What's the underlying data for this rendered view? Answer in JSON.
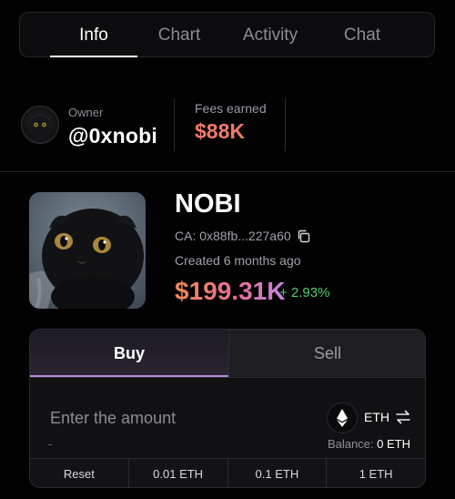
{
  "tabs": [
    "Info",
    "Chart",
    "Activity",
    "Chat"
  ],
  "owner": {
    "label": "Owner",
    "value": "@0xnobi"
  },
  "fees": {
    "label": "Fees earned",
    "value": "$88K"
  },
  "token": {
    "name": "NOBI",
    "ca": "CA: 0x88fb...227a60",
    "created": "Created 6 months ago",
    "price": "$199.31K",
    "change": "+ 2.93%"
  },
  "trade": {
    "buy_label": "Buy",
    "sell_label": "Sell",
    "amount_placeholder": "Enter the amount",
    "dash": "-",
    "currency": "ETH",
    "balance_label": "Balance:",
    "balance_value": "0 ETH",
    "quick": [
      "Reset",
      "0.01 ETH",
      "0.1 ETH",
      "1 ETH"
    ]
  },
  "colors": {
    "fees": "#ef7a68",
    "change": "#4fd06b",
    "buy_accent": "#b98ad6"
  },
  "icons": [
    "copy-icon",
    "ethereum-icon",
    "swap-icon"
  ]
}
